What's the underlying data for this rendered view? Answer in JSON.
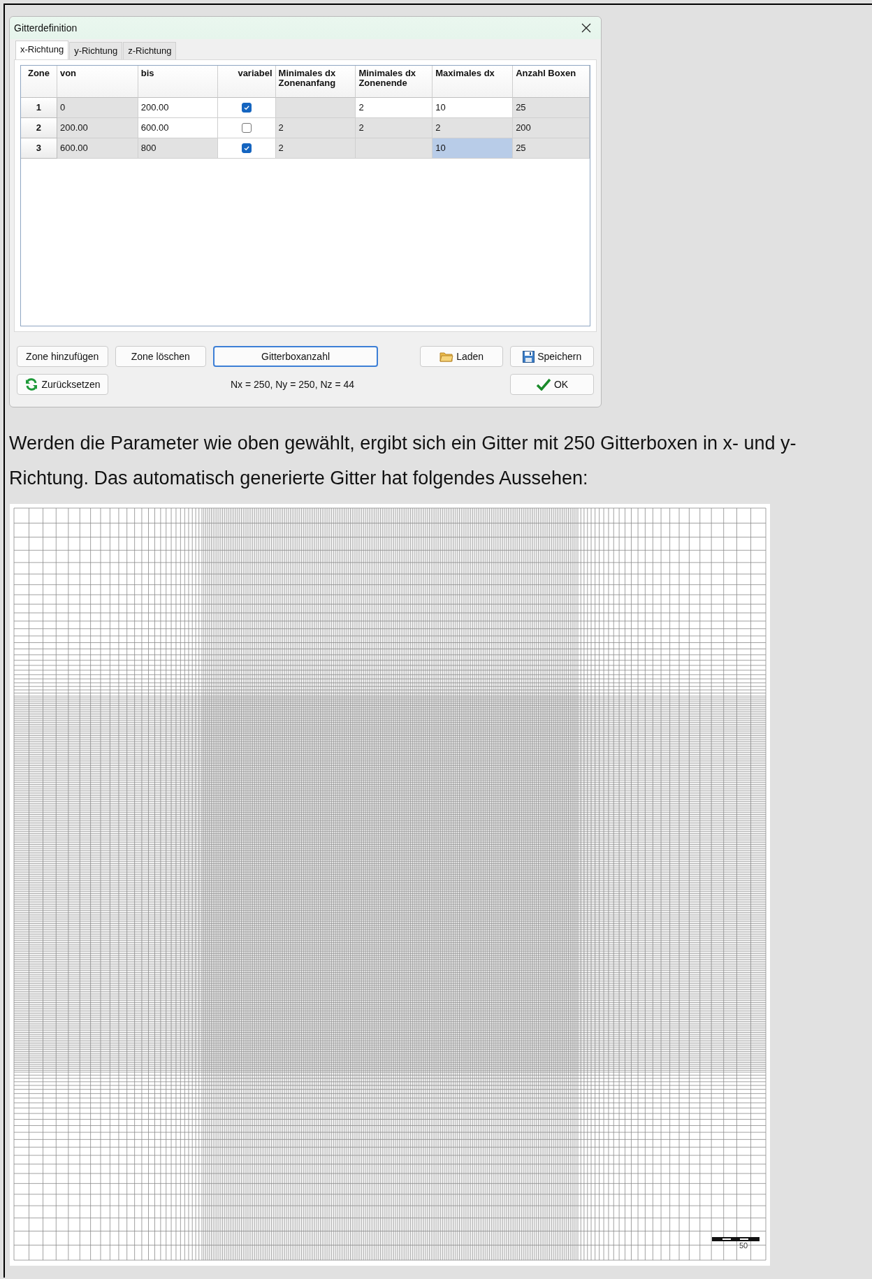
{
  "dialog": {
    "title": "Gitterdefinition",
    "tabs": [
      {
        "label": "x-Richtung",
        "selected": true
      },
      {
        "label": "y-Richtung",
        "selected": false
      },
      {
        "label": "z-Richtung",
        "selected": false
      }
    ],
    "table": {
      "columns": [
        "Zone",
        "von",
        "bis",
        "variabel",
        "Minimales dx Zonenanfang",
        "Minimales dx Zonenende",
        "Maximales dx",
        "Anzahl Boxen"
      ],
      "rows": [
        {
          "cells": [
            {
              "kind": "header",
              "text": "1"
            },
            {
              "kind": "text",
              "text": "0",
              "editable": false,
              "selected": false
            },
            {
              "kind": "text",
              "text": "200.00",
              "editable": true,
              "selected": false
            },
            {
              "kind": "checkbox",
              "checked": true,
              "editable": true
            },
            {
              "kind": "text",
              "editable": false,
              "selected": false
            },
            {
              "kind": "text",
              "text": "2",
              "editable": true,
              "selected": false
            },
            {
              "kind": "text",
              "text": "10",
              "editable": true,
              "selected": false
            },
            {
              "kind": "text",
              "text": "25",
              "editable": false,
              "selected": false
            }
          ]
        },
        {
          "cells": [
            {
              "kind": "header",
              "text": "2"
            },
            {
              "kind": "text",
              "text": "200.00",
              "editable": false,
              "selected": false
            },
            {
              "kind": "text",
              "text": "600.00",
              "editable": true,
              "selected": false
            },
            {
              "kind": "checkbox",
              "checked": false,
              "editable": true
            },
            {
              "kind": "text",
              "text": "2",
              "editable": false,
              "selected": false
            },
            {
              "kind": "text",
              "text": "2",
              "editable": false,
              "selected": false
            },
            {
              "kind": "text",
              "text": "2",
              "editable": false,
              "selected": false
            },
            {
              "kind": "text",
              "text": "200",
              "editable": false,
              "selected": false
            }
          ]
        },
        {
          "cells": [
            {
              "kind": "header",
              "text": "3"
            },
            {
              "kind": "text",
              "text": "600.00",
              "editable": false,
              "selected": false
            },
            {
              "kind": "text",
              "text": "800",
              "editable": false,
              "selected": false
            },
            {
              "kind": "checkbox",
              "checked": true,
              "editable": true
            },
            {
              "kind": "text",
              "text": "2",
              "editable": false,
              "selected": false
            },
            {
              "kind": "text",
              "editable": false,
              "selected": false
            },
            {
              "kind": "text",
              "text": "10",
              "editable": false,
              "selected": true
            },
            {
              "kind": "text",
              "text": "25",
              "editable": false,
              "selected": false
            }
          ]
        }
      ]
    },
    "buttons": {
      "add_zone": "Zone hinzufügen",
      "delete_zone": "Zone löschen",
      "box_count": {
        "label": "Gitterboxanzahl",
        "focused": true
      },
      "load": "Laden",
      "save": "Speichern",
      "reset": "Zurücksetzen",
      "ok": "OK"
    },
    "status": "Nx = 250, Ny = 250, Nz = 44"
  },
  "paragraph": "Werden die Parameter wie oben gewählt, ergibt sich ein Gitter mit 250 Gitterboxen in x- und y-Richtung. Das automatisch generierte Gitter hat folgendes Aussehen:",
  "grid_image": {
    "scale_label": "50"
  }
}
